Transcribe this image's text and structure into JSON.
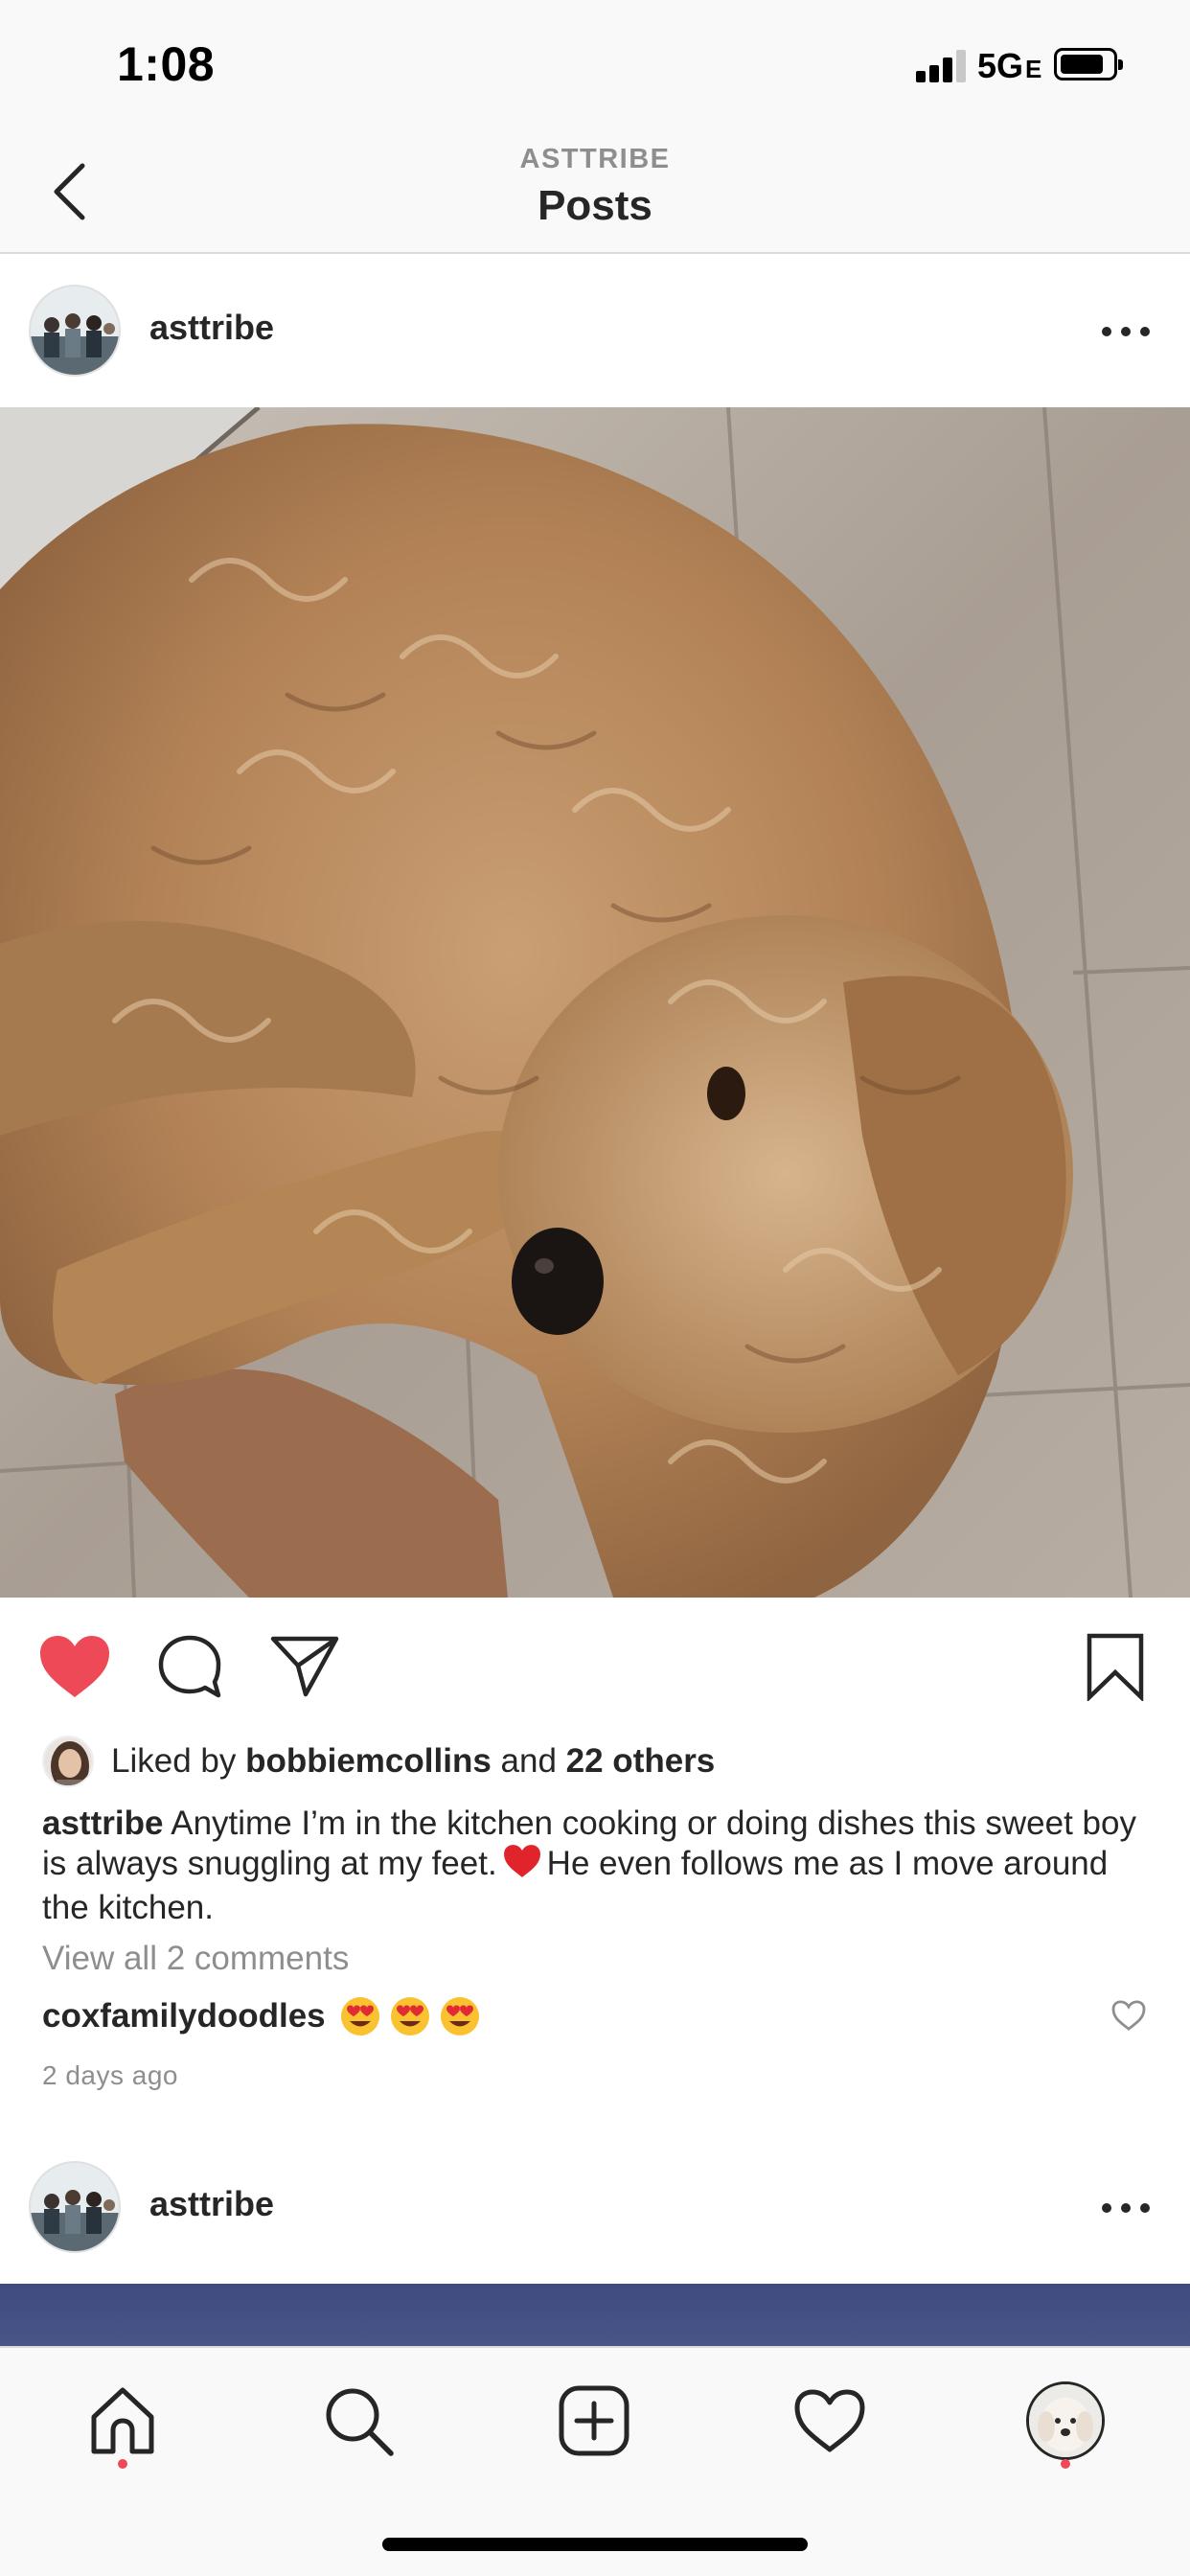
{
  "status_bar": {
    "time": "1:08",
    "network": "5G",
    "network_suffix": "E"
  },
  "header": {
    "subtitle": "ASTTRIBE",
    "title": "Posts",
    "back_icon": "chevron-left-icon"
  },
  "post": {
    "username": "asttribe",
    "photo_description": "dog-photo",
    "liked_by": {
      "prefix": "Liked by ",
      "user": "bobbiemcollins",
      "joiner": " and ",
      "others": "22 others"
    },
    "caption": {
      "username": "asttribe",
      "text_before": "Anytime I’m in the kitchen cooking or doing dishes this sweet boy is always snuggling at my feet.",
      "text_after": "He even follows me as I move around the kitchen."
    },
    "view_comments": "View all 2 comments",
    "comment": {
      "username": "coxfamilydoodles",
      "emoji": [
        "heart-eyes",
        "heart-eyes",
        "heart-eyes"
      ]
    },
    "timestamp": "2 days ago",
    "liked": true
  },
  "next_post": {
    "username": "asttribe"
  },
  "colors": {
    "like_red": "#ed4956",
    "text": "#262626",
    "secondary": "#8e8e8e",
    "bar_bg": "#f9f9f9"
  },
  "tab_bar": {
    "tabs": [
      "home-icon",
      "search-icon",
      "new-post-icon",
      "activity-icon",
      "profile-icon"
    ]
  }
}
